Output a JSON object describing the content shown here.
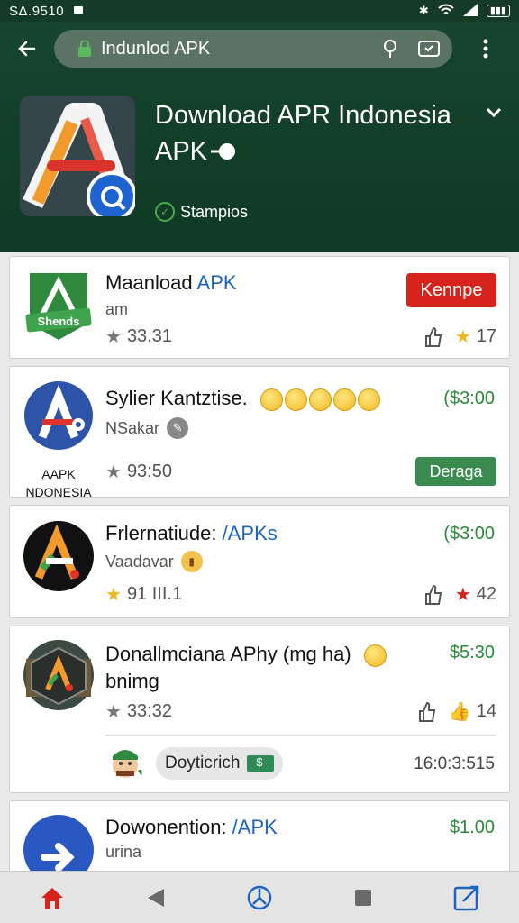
{
  "status": {
    "time": "SΔ.9510"
  },
  "browser": {
    "url": "Indunlod APK"
  },
  "hero": {
    "title_line1": "Download APR Indonesia",
    "title_line2": "APK",
    "badge": "Stampios"
  },
  "cards": [
    {
      "title": "Maanload",
      "title_accent": "APK",
      "sub": "am",
      "rating": "33.31",
      "button": "Kennpe",
      "count": "17",
      "icon_label": "Shends"
    },
    {
      "title": "Sylier Kantztise.",
      "sub": "NSakar",
      "rating": "93:50",
      "price": "($3:00",
      "button": "Deraga",
      "icon_label_line1": "AAPK",
      "icon_label_line2": "NDONESIA"
    },
    {
      "title": "Frlernatiude:",
      "title_accent": "/APKs",
      "sub": "Vaadavar",
      "rating": "91 III.1",
      "price": "($3:00",
      "count": "42"
    },
    {
      "title": "Donallmciana APhy (mg ha)",
      "title_line2": "bnimg",
      "rating": "33:32",
      "price": "$5:30",
      "count": "14",
      "user": "Doyticrich",
      "timestamp": "16:0:3:515"
    },
    {
      "title": "Dowonention:",
      "title_accent": "/APK",
      "sub": "urina",
      "price": "$1.00"
    }
  ],
  "colors": {
    "header": "#133b26",
    "accent": "#1d64c2",
    "price": "#2a8a3a",
    "danger": "#d6231c"
  }
}
